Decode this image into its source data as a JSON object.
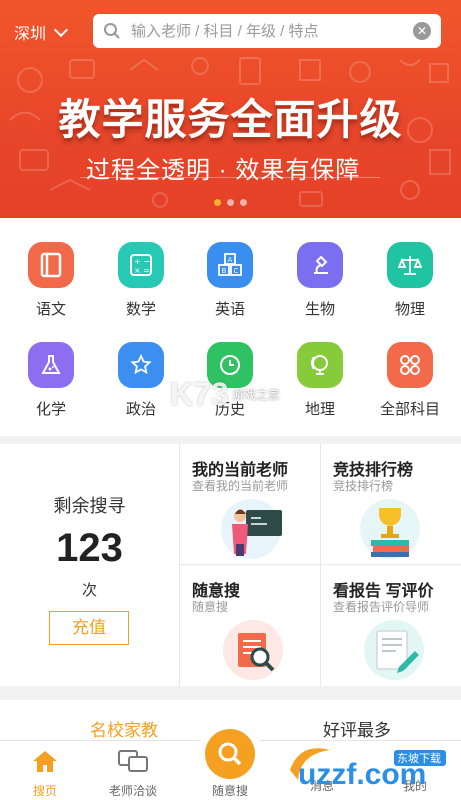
{
  "header": {
    "city": "深圳",
    "search_placeholder": "输入老师 / 科目 / 年级 / 特点"
  },
  "banner": {
    "title": "教学服务全面升级",
    "subtitle": "过程全透明 · 效果有保障",
    "slide_count": 3,
    "active_slide": 1
  },
  "subjects": [
    {
      "label": "语文",
      "icon": "book-icon",
      "color": "#f2694a"
    },
    {
      "label": "数学",
      "icon": "calculator-icon",
      "color": "#28c9b4"
    },
    {
      "label": "英语",
      "icon": "abc-blocks-icon",
      "color": "#3a8ef0"
    },
    {
      "label": "生物",
      "icon": "microscope-icon",
      "color": "#7a6ff0"
    },
    {
      "label": "物理",
      "icon": "scales-icon",
      "color": "#20c3a2"
    },
    {
      "label": "化学",
      "icon": "flask-icon",
      "color": "#8e6ef0"
    },
    {
      "label": "政治",
      "icon": "star-badge-icon",
      "color": "#3c8ff0"
    },
    {
      "label": "历史",
      "icon": "clock-icon",
      "color": "#2fc262"
    },
    {
      "label": "地理",
      "icon": "globe-icon",
      "color": "#86cc3a"
    },
    {
      "label": "全部科目",
      "icon": "grid-flower-icon",
      "color": "#f26a4a"
    }
  ],
  "remaining": {
    "title": "剩余搜寻",
    "count": "123",
    "unit": "次",
    "recharge_label": "充值"
  },
  "cards": [
    {
      "title": "我的当前老师",
      "subtitle": "查看我的当前老师",
      "icon": "teacher-blackboard-icon"
    },
    {
      "title": "竞技排行榜",
      "subtitle": "竞技排行榜",
      "icon": "trophy-books-icon"
    },
    {
      "title": "随意搜",
      "subtitle": "随意搜",
      "icon": "document-search-icon"
    },
    {
      "title": "看报告 写评价",
      "subtitle": "查看报告评价导师",
      "icon": "report-pen-icon"
    }
  ],
  "recommend": {
    "left": "名校家教",
    "right": "好评最多"
  },
  "tabbar": [
    {
      "label": "搜页",
      "icon": "home-icon",
      "active": true
    },
    {
      "label": "老师洽谈",
      "icon": "chat-bubbles-icon",
      "active": false
    },
    {
      "label": "随意搜",
      "icon": "search-icon",
      "active": false
    },
    {
      "label": "消息",
      "icon": "message-icon",
      "active": false
    },
    {
      "label": "我的",
      "icon": "profile-icon",
      "active": false
    }
  ],
  "watermarks": {
    "k73": "K73",
    "k73_sub": "游戏之家",
    "uzzf": "uzzf.com",
    "uzzf_sub": "东坡下载"
  }
}
